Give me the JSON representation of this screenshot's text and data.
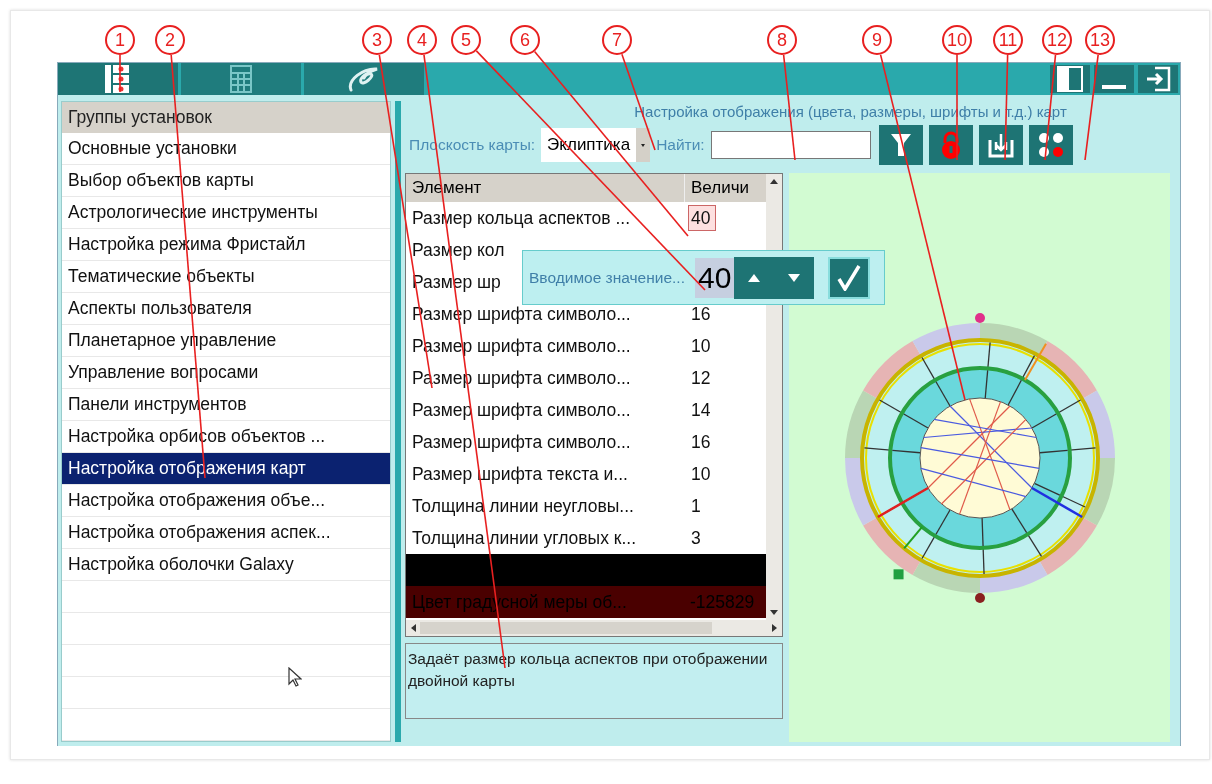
{
  "window": {
    "tabs": [
      {
        "kind": "list",
        "selected": true
      },
      {
        "kind": "grid",
        "selected": false
      },
      {
        "kind": "logo",
        "selected": false
      }
    ],
    "controls": [
      {
        "kind": "panel"
      },
      {
        "kind": "minimize"
      },
      {
        "kind": "exit"
      }
    ]
  },
  "settings_groups": {
    "header": "Группы установок",
    "items": [
      {
        "label": "Основные установки",
        "selected": false
      },
      {
        "label": "Выбор объектов карты",
        "selected": false
      },
      {
        "label": "Астрологические инструменты",
        "selected": false
      },
      {
        "label": "Настройка режима Фристайл",
        "selected": false
      },
      {
        "label": "Тематические объекты",
        "selected": false
      },
      {
        "label": "Аспекты пользователя",
        "selected": false
      },
      {
        "label": "Планетарное управление",
        "selected": false
      },
      {
        "label": "Управление вопросами",
        "selected": false
      },
      {
        "label": "Панели инструментов",
        "selected": false
      },
      {
        "label": "Настройка орбисов объектов ...",
        "selected": false
      },
      {
        "label": "Настройка отображения карт",
        "selected": true
      },
      {
        "label": "Настройка отображения объе...",
        "selected": false
      },
      {
        "label": "Настройка отображения аспек...",
        "selected": false
      },
      {
        "label": "Настройка оболочки Galaxy",
        "selected": false
      }
    ]
  },
  "panel": {
    "caption": "Настройка отображения (цвета, размеры, шрифты и т.д.) карт",
    "plane_label": "Плоскость карты:",
    "plane_value": "Эклиптика",
    "find_label": "Найти:",
    "tools": [
      {
        "kind": "filter"
      },
      {
        "kind": "lock"
      },
      {
        "kind": "download"
      },
      {
        "kind": "dots"
      }
    ]
  },
  "table": {
    "columns": [
      "Элемент",
      "Величи"
    ],
    "rows": [
      {
        "kind": "text",
        "element": "Размер кольца аспектов ...",
        "value": "40",
        "editing": true
      },
      {
        "kind": "text",
        "element": "Размер кол"
      },
      {
        "kind": "text",
        "element": "Размер шр"
      },
      {
        "kind": "text",
        "element": "Размер шрифта символо...",
        "value": "16",
        "editing": false
      },
      {
        "kind": "text",
        "element": "Размер шрифта символо...",
        "value": "10",
        "editing": false
      },
      {
        "kind": "text",
        "element": "Размер шрифта символо...",
        "value": "12",
        "editing": false
      },
      {
        "kind": "text",
        "element": "Размер шрифта символо...",
        "value": "14",
        "editing": false
      },
      {
        "kind": "text",
        "element": "Размер шрифта символо...",
        "value": "16",
        "editing": false
      },
      {
        "kind": "text",
        "element": "Размер шрифта текста и...",
        "value": "10",
        "editing": false
      },
      {
        "kind": "text",
        "element": "Толщина линии неугловы...",
        "value": "1",
        "editing": false
      },
      {
        "kind": "text",
        "element": "Толщина линии угловых к...",
        "value": "3",
        "editing": false
      },
      {
        "kind": "color",
        "color": "#000000"
      },
      {
        "kind": "color",
        "color": "#4a0000",
        "element": "Цвет градусной меры об...",
        "value": "-125829"
      }
    ]
  },
  "description": "Задаёт размер кольца аспектов при отображении двойной карты",
  "value_popup": {
    "label": "Вводимое значение...",
    "value": "40"
  },
  "callouts": [
    "1",
    "2",
    "3",
    "4",
    "5",
    "6",
    "7",
    "8",
    "9",
    "10",
    "11",
    "12",
    "13"
  ]
}
